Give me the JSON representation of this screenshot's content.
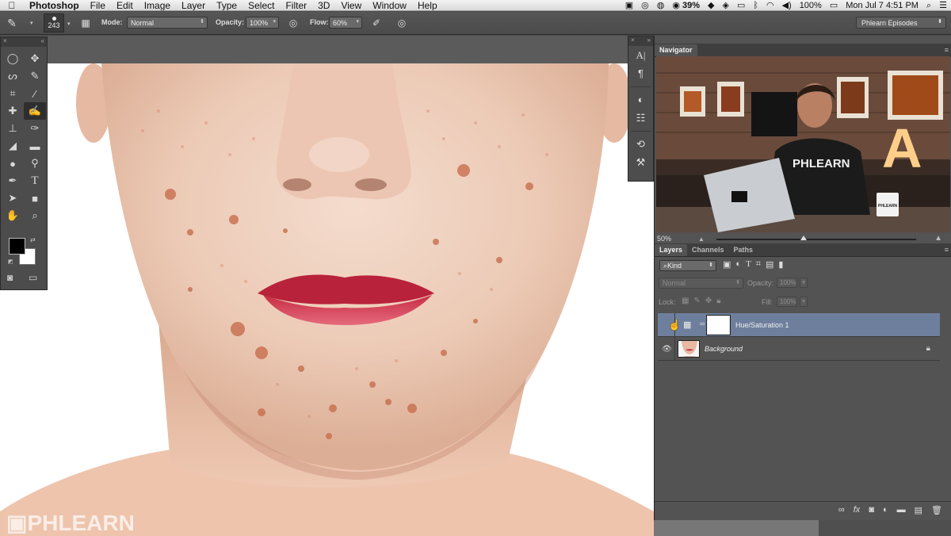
{
  "menubar": {
    "apple": "",
    "items": [
      "Photoshop",
      "File",
      "Edit",
      "Image",
      "Layer",
      "Type",
      "Select",
      "Filter",
      "3D",
      "View",
      "Window",
      "Help"
    ],
    "status": {
      "battery": "39%",
      "volume_level": "100%",
      "datetime": "Mon Jul 7  4:51 PM"
    }
  },
  "options": {
    "brush_size": "243",
    "mode_label": "Mode:",
    "mode_value": "Normal",
    "opacity_label": "Opacity:",
    "opacity_value": "100%",
    "flow_label": "Flow:",
    "flow_value": "60%",
    "workspace": "Phlearn Episodes"
  },
  "navigator": {
    "tab": "Navigator",
    "zoom": "50%",
    "shirt_text": "PHLEARN",
    "sign_letter": "A",
    "mug_text": "PHLEARN"
  },
  "layers_panel": {
    "tabs": [
      "Layers",
      "Channels",
      "Paths"
    ],
    "kind_label": "Kind",
    "blend_mode": "Normal",
    "opacity_label": "Opacity:",
    "opacity_value": "100%",
    "lock_label": "Lock:",
    "fill_label": "Fill:",
    "fill_value": "100%",
    "layers": [
      {
        "name": "Hue/Saturation 1",
        "selected": true
      },
      {
        "name": "Background",
        "selected": false
      }
    ]
  },
  "watermark": "PHLEARN",
  "colors": {
    "panel_bg": "#535353",
    "selected_layer": "#6d7f9c",
    "foreground": "#000000",
    "background": "#ffffff"
  }
}
